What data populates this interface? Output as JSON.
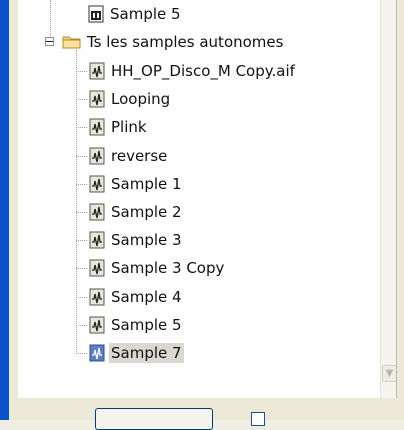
{
  "tree": {
    "partial_item": {
      "label": "Sample 5",
      "icon": "midi-file-icon"
    },
    "folder": {
      "label": "Ts les samples autonomes",
      "expander": "−",
      "icon": "folder-icon"
    },
    "items": [
      {
        "label": "HH_OP_Disco_M Copy.aif",
        "icon": "audio-file-icon",
        "selected": false
      },
      {
        "label": "Looping",
        "icon": "audio-file-icon",
        "selected": false
      },
      {
        "label": "Plink",
        "icon": "audio-file-icon",
        "selected": false
      },
      {
        "label": "reverse",
        "icon": "audio-file-icon",
        "selected": false
      },
      {
        "label": "Sample 1",
        "icon": "audio-file-icon",
        "selected": false
      },
      {
        "label": "Sample 2",
        "icon": "audio-file-icon",
        "selected": false
      },
      {
        "label": "Sample 3",
        "icon": "audio-file-icon",
        "selected": false
      },
      {
        "label": "Sample 3 Copy",
        "icon": "audio-file-icon",
        "selected": false
      },
      {
        "label": "Sample 4",
        "icon": "audio-file-icon",
        "selected": false
      },
      {
        "label": "Sample 5",
        "icon": "audio-file-icon",
        "selected": false
      },
      {
        "label": "Sample 7",
        "icon": "audio-file-icon-selected",
        "selected": true
      }
    ]
  },
  "scrollbar": {
    "down_arrow": "▼"
  },
  "colors": {
    "window_frame": "#0a52c8",
    "panel": "#ece9d8",
    "tree_bg": "#ffffff",
    "selection": "#d9d7cf"
  }
}
